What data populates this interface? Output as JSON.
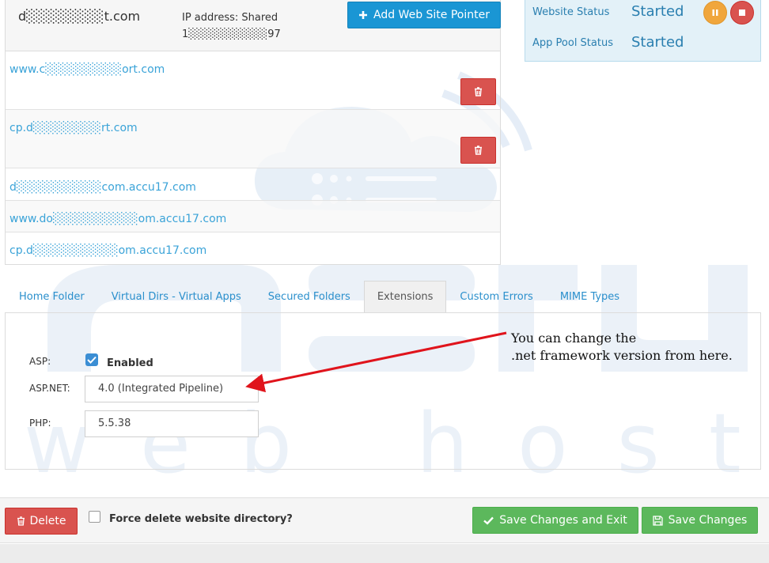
{
  "pointers": {
    "domain": "d░░░░░░░░t.com",
    "ip_label": "IP address: Shared",
    "ip_value": "1░░░░░░░░░░97",
    "add_button": "Add Web Site Pointer",
    "rows": [
      {
        "host": "www.c░░░░░░░░░ort.com",
        "deletable": true
      },
      {
        "host": "cp.d░░░░░░░░rt.com",
        "deletable": true
      },
      {
        "host": "d░░░░░░░░░░com.accu17.com",
        "deletable": false
      },
      {
        "host": "www.do░░░░░░░░░░om.accu17.com",
        "deletable": false
      },
      {
        "host": "cp.d░░░░░░░░░░om.accu17.com",
        "deletable": false
      }
    ]
  },
  "status": {
    "website_label": "Website Status",
    "website_value": "Started",
    "apppool_label": "App Pool Status",
    "apppool_value": "Started"
  },
  "tabs": [
    {
      "label": "Home Folder",
      "active": false
    },
    {
      "label": "Virtual Dirs - Virtual Apps",
      "active": false
    },
    {
      "label": "Secured Folders",
      "active": false
    },
    {
      "label": "Extensions",
      "active": true
    },
    {
      "label": "Custom Errors",
      "active": false
    },
    {
      "label": "MIME Types",
      "active": false
    }
  ],
  "extensions": {
    "asp_label": "ASP:",
    "asp_checked": true,
    "asp_enabled_text": "Enabled",
    "aspnet_label": "ASP.NET:",
    "aspnet_value": "4.0 (Integrated Pipeline)",
    "php_label": "PHP:",
    "php_value": "5.5.38"
  },
  "annotation": {
    "line1": "You can change the",
    "line2": ".net framework version from here."
  },
  "footer": {
    "delete_label": "Delete",
    "force_delete_label": "Force delete website directory?",
    "save_exit_label": "Save Changes and Exit",
    "save_label": "Save Changes"
  },
  "watermark": {
    "word": "web hosting"
  },
  "colors": {
    "primary": "#1a96d4",
    "danger": "#d9534f",
    "success": "#5cb85c",
    "warning": "#f0a63c",
    "link": "#3aa3d8"
  }
}
